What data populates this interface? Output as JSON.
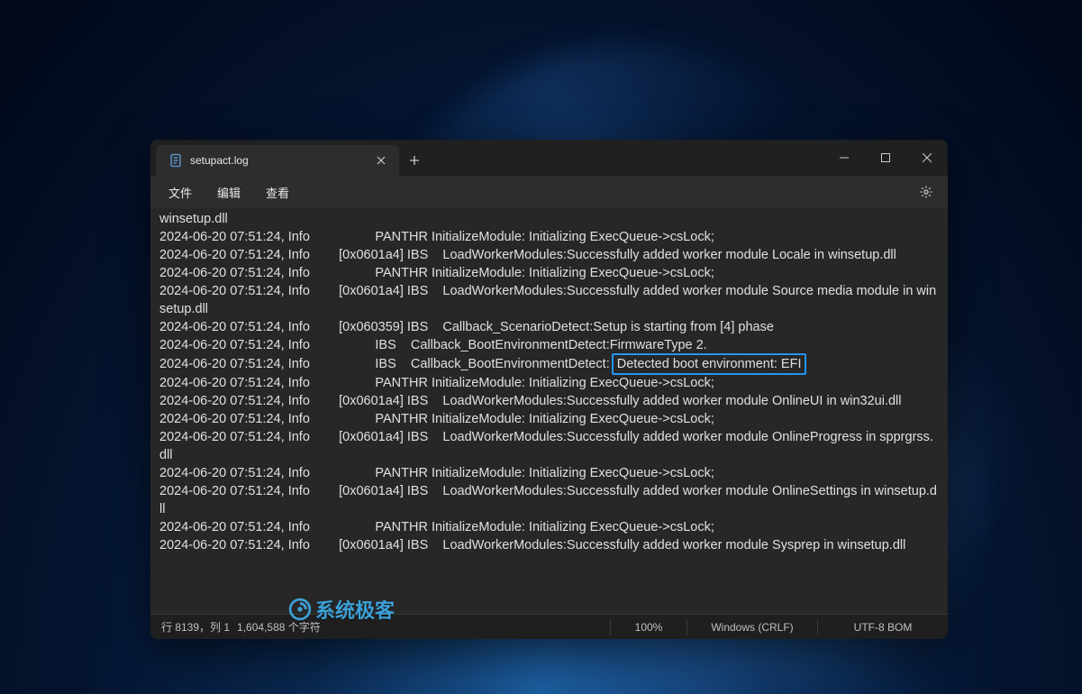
{
  "tab": {
    "title": "setupact.log"
  },
  "menu": {
    "file": "文件",
    "edit": "编辑",
    "view": "查看"
  },
  "log": {
    "lines": [
      "winsetup.dll",
      "2024-06-20 07:51:24, Info                  PANTHR InitializeModule: Initializing ExecQueue->csLock;",
      "2024-06-20 07:51:24, Info        [0x0601a4] IBS    LoadWorkerModules:Successfully added worker module Locale in winsetup.dll",
      "2024-06-20 07:51:24, Info                  PANTHR InitializeModule: Initializing ExecQueue->csLock;",
      "2024-06-20 07:51:24, Info        [0x0601a4] IBS    LoadWorkerModules:Successfully added worker module Source media module in winsetup.dll",
      "2024-06-20 07:51:24, Info        [0x060359] IBS    Callback_ScenarioDetect:Setup is starting from [4] phase",
      "2024-06-20 07:51:24, Info                  IBS    Callback_BootEnvironmentDetect:FirmwareType 2.",
      "2024-06-20 07:51:24, Info                  IBS    Callback_BootEnvironmentDetect: ",
      "2024-06-20 07:51:24, Info                  PANTHR InitializeModule: Initializing ExecQueue->csLock;",
      "2024-06-20 07:51:24, Info        [0x0601a4] IBS    LoadWorkerModules:Successfully added worker module OnlineUI in win32ui.dll",
      "2024-06-20 07:51:24, Info                  PANTHR InitializeModule: Initializing ExecQueue->csLock;",
      "2024-06-20 07:51:24, Info        [0x0601a4] IBS    LoadWorkerModules:Successfully added worker module OnlineProgress in spprgrss.dll",
      "2024-06-20 07:51:24, Info                  PANTHR InitializeModule: Initializing ExecQueue->csLock;",
      "2024-06-20 07:51:24, Info        [0x0601a4] IBS    LoadWorkerModules:Successfully added worker module OnlineSettings in winsetup.dll",
      "2024-06-20 07:51:24, Info                  PANTHR InitializeModule: Initializing ExecQueue->csLock;",
      "2024-06-20 07:51:24, Info        [0x0601a4] IBS    LoadWorkerModules:Successfully added worker module Sysprep in winsetup.dll"
    ],
    "highlight_text": "Detected boot environment: EFI",
    "highlight_line_index": 7
  },
  "status": {
    "position": "行 8139，列 1",
    "chars": "1,604,588 个字符",
    "zoom": "100%",
    "line_endings": "Windows (CRLF)",
    "encoding": "UTF-8 BOM"
  },
  "watermark": {
    "text": "系统极客"
  }
}
